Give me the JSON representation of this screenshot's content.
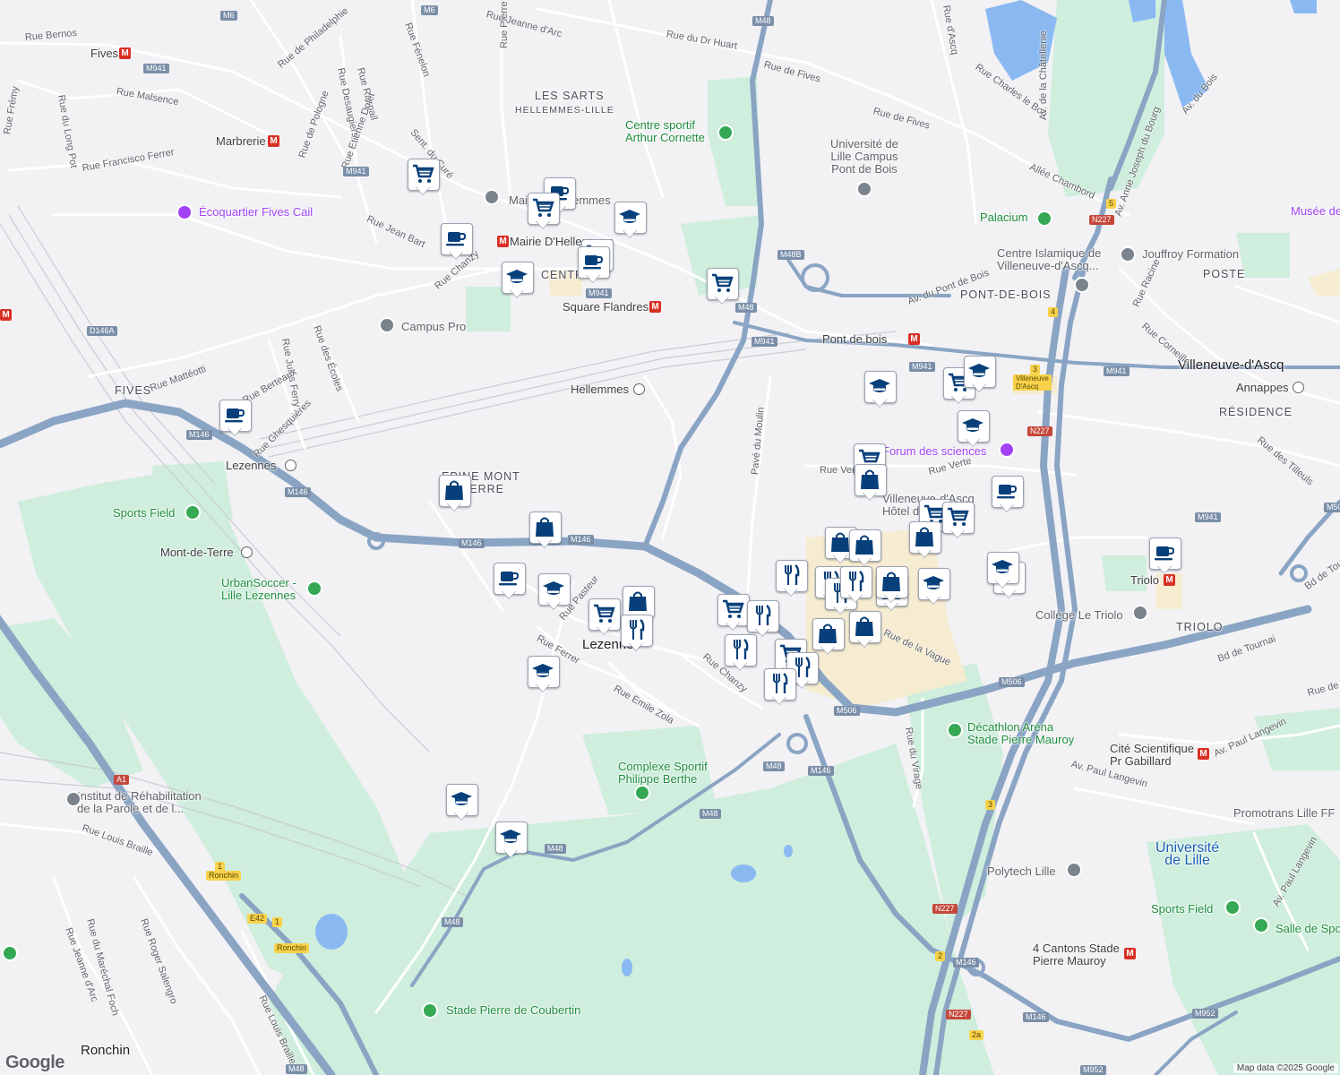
{
  "map": {
    "attribution": "Map data ©2025 Google",
    "logo_text": "Google",
    "colors": {
      "land": "#f2f1f4",
      "park": "#cfeedd",
      "commercial": "#f6ecd2",
      "water": "#8ab9f2",
      "highway": "#8aa4c4",
      "road": "#ffffff",
      "pin": "#063f7a"
    }
  },
  "labels": {
    "area": [
      {
        "id": "les-sarts",
        "text": "LES SARTS"
      },
      {
        "id": "hellemmes-lille",
        "text": "HELLEMMES-LILLE"
      },
      {
        "id": "centre",
        "text": "CENTRE"
      },
      {
        "id": "pont-de-bois",
        "text": "PONT-DE-BOIS"
      },
      {
        "id": "poste",
        "text": "POSTE"
      },
      {
        "id": "residence",
        "text": "RÉSIDENCE"
      },
      {
        "id": "fives-area",
        "text": "FIVES"
      },
      {
        "id": "epine-mont",
        "text": "EPINE MONT"
      },
      {
        "id": "de-terre",
        "text": "DE TERRE"
      },
      {
        "id": "triolo-area",
        "text": "TRIOLO"
      }
    ],
    "cities": [
      {
        "id": "lezennes",
        "text": "Lezennes"
      },
      {
        "id": "ronchin",
        "text": "Ronchin"
      },
      {
        "id": "villeneuve",
        "text": "Villeneuve-d'Ascq"
      },
      {
        "id": "universite",
        "text": "Université\nde Lille"
      }
    ],
    "poi_green": [
      {
        "id": "centre-sportif",
        "text": "Centre sportif\nArthur Cornette"
      },
      {
        "id": "palacium",
        "text": "Palacium"
      },
      {
        "id": "sports-field-1",
        "text": "Sports Field"
      },
      {
        "id": "urbansoccer",
        "text": "UrbanSoccer -\nLille Lezennes"
      },
      {
        "id": "complexe",
        "text": "Complexe Sportif\nPhilippe Berthe"
      },
      {
        "id": "decathlon",
        "text": "Décathlon Aréna\nStade Pierre Mauroy"
      },
      {
        "id": "sports-field-2",
        "text": "Sports Field"
      },
      {
        "id": "salle",
        "text": "Salle de Spo"
      },
      {
        "id": "stade-coubertin",
        "text": "Stade Pierre de Coubertin"
      }
    ],
    "poi_purple": [
      {
        "id": "ecoquartier",
        "text": "Écoquartier Fives Cail"
      },
      {
        "id": "forum",
        "text": "Forum des sciences"
      },
      {
        "id": "musee",
        "text": "Musée de"
      }
    ],
    "poi_gray": [
      {
        "id": "univ-campus",
        "text": "Université de\nLille Campus\nPont de Bois"
      },
      {
        "id": "centre-islamique",
        "text": "Centre Islamique de\nVilleneuve-d'Ascq..."
      },
      {
        "id": "jouffroy",
        "text": "Jouffroy Formation"
      },
      {
        "id": "campus-pro",
        "text": "Campus Pro"
      },
      {
        "id": "college-triolo",
        "text": "Collège Le Triolo"
      },
      {
        "id": "institut",
        "text": "Institut de Réhabilitation\nde la Parole et de l..."
      },
      {
        "id": "polytech",
        "text": "Polytech Lille"
      },
      {
        "id": "promotrans",
        "text": "Promotrans Lille FF"
      },
      {
        "id": "mairie-hellemmes",
        "text": "Mairie d'Hellemmes"
      },
      {
        "id": "hotel-ville",
        "text": "Villeneuve-d'Ascq\nHôtel de Ville"
      }
    ],
    "metro": [
      {
        "id": "fives",
        "text": "Fives"
      },
      {
        "id": "marbrerie",
        "text": "Marbrerie"
      },
      {
        "id": "mairie-hellemmes-m",
        "text": "Mairie D'Hellemmes"
      },
      {
        "id": "square-flandres",
        "text": "Square Flandres"
      },
      {
        "id": "pont-de-bois-m",
        "text": "Pont de bois"
      },
      {
        "id": "triolo",
        "text": "Triolo"
      },
      {
        "id": "cite-scientifique",
        "text": "Cité Scientifique\nPr Gabillard"
      },
      {
        "id": "4-cantons",
        "text": "4 Cantons Stade\nPierre Mauroy"
      }
    ],
    "train": [
      {
        "id": "hellemmes",
        "text": "Hellemmes"
      },
      {
        "id": "lezennes-train",
        "text": "Lezennes"
      },
      {
        "id": "mont-de-terre",
        "text": "Mont-de-Terre"
      },
      {
        "id": "annappes",
        "text": "Annappes"
      }
    ],
    "streets": [
      {
        "id": "s1",
        "text": "Rue Bernos"
      },
      {
        "id": "s2",
        "text": "Rue de Philadelphie"
      },
      {
        "id": "s3",
        "text": "Rue Raspail"
      },
      {
        "id": "s4",
        "text": "Rue Desaugiers"
      },
      {
        "id": "s5",
        "text": "Rue Fénelon"
      },
      {
        "id": "s6",
        "text": "Rue Jeanne d'Arc"
      },
      {
        "id": "s7",
        "text": "Rue Pierre Curie"
      },
      {
        "id": "s8",
        "text": "Rue du Dr Huart"
      },
      {
        "id": "s9",
        "text": "Rue de Fives"
      },
      {
        "id": "s10",
        "text": "Rue de Fives"
      },
      {
        "id": "s11",
        "text": "Rue Charles le Bon"
      },
      {
        "id": "s12",
        "text": "Av. de la Châtellenie"
      },
      {
        "id": "s13",
        "text": "Av. du Bois"
      },
      {
        "id": "s14",
        "text": "Rue Malsence"
      },
      {
        "id": "s15",
        "text": "Rue de Pologne"
      },
      {
        "id": "s16",
        "text": "Rue Etienne Dolet"
      },
      {
        "id": "s17",
        "text": "Sent. du Curé"
      },
      {
        "id": "s18",
        "text": "Rue Frémy"
      },
      {
        "id": "s19",
        "text": "Rue du Long Pot"
      },
      {
        "id": "s20",
        "text": "Rue Francisco Ferrer"
      },
      {
        "id": "s21",
        "text": "Rue Jean Bart"
      },
      {
        "id": "s22",
        "text": "Rue Chanzy"
      },
      {
        "id": "s23",
        "text": "Allée Chambord"
      },
      {
        "id": "s24",
        "text": "Av. Anne Joseph du Bourg"
      },
      {
        "id": "s25",
        "text": "Av. du Pont de Bois"
      },
      {
        "id": "s26",
        "text": "Rue Racine"
      },
      {
        "id": "s27",
        "text": "Rue Corneille"
      },
      {
        "id": "s28",
        "text": "Rue Mattéotti"
      },
      {
        "id": "s29",
        "text": "Rue Jules Ferry"
      },
      {
        "id": "s30",
        "text": "Rue des Écoles"
      },
      {
        "id": "s31",
        "text": "Rue Berteaux"
      },
      {
        "id": "s32",
        "text": "Rue Ghesquières"
      },
      {
        "id": "s33",
        "text": "Pavé du Moulin"
      },
      {
        "id": "s34",
        "text": "Rue Verte"
      },
      {
        "id": "s35",
        "text": "Rue Verte"
      },
      {
        "id": "s36",
        "text": "Rue des Tilleuls"
      },
      {
        "id": "s37",
        "text": "Rue Pasteur"
      },
      {
        "id": "s38",
        "text": "Rue Ferrer"
      },
      {
        "id": "s39",
        "text": "Rue Chanzy"
      },
      {
        "id": "s40",
        "text": "Rue Emile Zola"
      },
      {
        "id": "s41",
        "text": "Bd de Tournai"
      },
      {
        "id": "s42",
        "text": "Bd de Tournai"
      },
      {
        "id": "s43",
        "text": "Rue de la Vague"
      },
      {
        "id": "s44",
        "text": "Rue du Virage"
      },
      {
        "id": "s45",
        "text": "Av. Paul Langevin"
      },
      {
        "id": "s46",
        "text": "Av. Paul Langevin"
      },
      {
        "id": "s47",
        "text": "Av. Paul Langevin"
      },
      {
        "id": "s48",
        "text": "Rue Louis Braille"
      },
      {
        "id": "s49",
        "text": "Rue du Maréchal Foch"
      },
      {
        "id": "s50",
        "text": "Rue Roger Salengro"
      },
      {
        "id": "s51",
        "text": "Rue Jeanne d'Arc"
      },
      {
        "id": "s52",
        "text": "Rue Louis Braille"
      },
      {
        "id": "s53",
        "text": "Rue de"
      },
      {
        "id": "s54",
        "text": "Rue d'Ascq"
      }
    ],
    "shields": [
      {
        "id": "r1",
        "text": "M6"
      },
      {
        "id": "r2",
        "text": "M6"
      },
      {
        "id": "r3",
        "text": "M941"
      },
      {
        "id": "r4",
        "text": "M941"
      },
      {
        "id": "r5",
        "text": "M48"
      },
      {
        "id": "r6",
        "text": "M48B"
      },
      {
        "id": "r7",
        "text": "M48"
      },
      {
        "id": "r8",
        "text": "M941"
      },
      {
        "id": "r9",
        "text": "M941"
      },
      {
        "id": "r10",
        "text": "M941"
      },
      {
        "id": "r11",
        "text": "M941"
      },
      {
        "id": "r12",
        "text": "D146A"
      },
      {
        "id": "r13",
        "text": "M146"
      },
      {
        "id": "r14",
        "text": "M146"
      },
      {
        "id": "r15",
        "text": "M146"
      },
      {
        "id": "r16",
        "text": "M146"
      },
      {
        "id": "r17",
        "text": "M506"
      },
      {
        "id": "r18",
        "text": "M506"
      },
      {
        "id": "r19",
        "text": "M48"
      },
      {
        "id": "r20",
        "text": "M146"
      },
      {
        "id": "r21",
        "text": "M48"
      },
      {
        "id": "r22",
        "text": "M48"
      },
      {
        "id": "r23",
        "text": "M48"
      },
      {
        "id": "r24",
        "text": "M48"
      },
      {
        "id": "r25",
        "text": "M146"
      },
      {
        "id": "r26",
        "text": "M146"
      },
      {
        "id": "r27",
        "text": "M952"
      },
      {
        "id": "r28",
        "text": "M952"
      },
      {
        "id": "r29",
        "text": "M941"
      },
      {
        "id": "r30",
        "text": "M50"
      },
      {
        "id": "r31",
        "text": "A1"
      },
      {
        "id": "r32",
        "text": "E42"
      },
      {
        "id": "r33",
        "text": "N227"
      },
      {
        "id": "r34",
        "text": "N227"
      },
      {
        "id": "r35",
        "text": "N227"
      },
      {
        "id": "r36",
        "text": "N227"
      },
      {
        "id": "r37",
        "text": "5"
      },
      {
        "id": "r38",
        "text": "4"
      },
      {
        "id": "r39",
        "text": "3"
      },
      {
        "id": "r40",
        "text": "3"
      },
      {
        "id": "r41",
        "text": "2"
      },
      {
        "id": "r42",
        "text": "2a"
      },
      {
        "id": "r43",
        "text": "1"
      },
      {
        "id": "r44",
        "text": "1"
      },
      {
        "id": "r45",
        "text": "Villeneuve\nD'Ascq"
      },
      {
        "id": "r46",
        "text": "Ronchin"
      },
      {
        "id": "r47",
        "text": "Ronchin"
      }
    ]
  },
  "markers": [
    {
      "icon": "cart"
    },
    {
      "icon": "coffee"
    },
    {
      "icon": "cart"
    },
    {
      "icon": "school"
    },
    {
      "icon": "coffee"
    },
    {
      "icon": "cart"
    },
    {
      "icon": "coffee"
    },
    {
      "icon": "school"
    },
    {
      "icon": "cart"
    },
    {
      "icon": "coffee"
    },
    {
      "icon": "bag"
    },
    {
      "icon": "bag"
    },
    {
      "icon": "coffee"
    },
    {
      "icon": "school"
    },
    {
      "icon": "cart"
    },
    {
      "icon": "bag"
    },
    {
      "icon": "fork"
    },
    {
      "icon": "school"
    },
    {
      "icon": "school"
    },
    {
      "icon": "school"
    },
    {
      "icon": "school"
    },
    {
      "icon": "cart"
    },
    {
      "icon": "school"
    },
    {
      "icon": "school"
    },
    {
      "icon": "cart"
    },
    {
      "icon": "bag"
    },
    {
      "icon": "coffee"
    },
    {
      "icon": "cart"
    },
    {
      "icon": "cart"
    },
    {
      "icon": "bag"
    },
    {
      "icon": "bag"
    },
    {
      "icon": "bag"
    },
    {
      "icon": "fork"
    },
    {
      "icon": "fork"
    },
    {
      "icon": "fork"
    },
    {
      "icon": "bag"
    },
    {
      "icon": "bag"
    },
    {
      "icon": "school"
    },
    {
      "icon": "school"
    },
    {
      "icon": "coffee"
    },
    {
      "icon": "cart"
    },
    {
      "icon": "fork"
    },
    {
      "icon": "fork"
    },
    {
      "icon": "cart"
    },
    {
      "icon": "fork"
    },
    {
      "icon": "fork"
    },
    {
      "icon": "bag"
    },
    {
      "icon": "bag"
    },
    {
      "icon": "fork"
    },
    {
      "icon": "school"
    }
  ]
}
